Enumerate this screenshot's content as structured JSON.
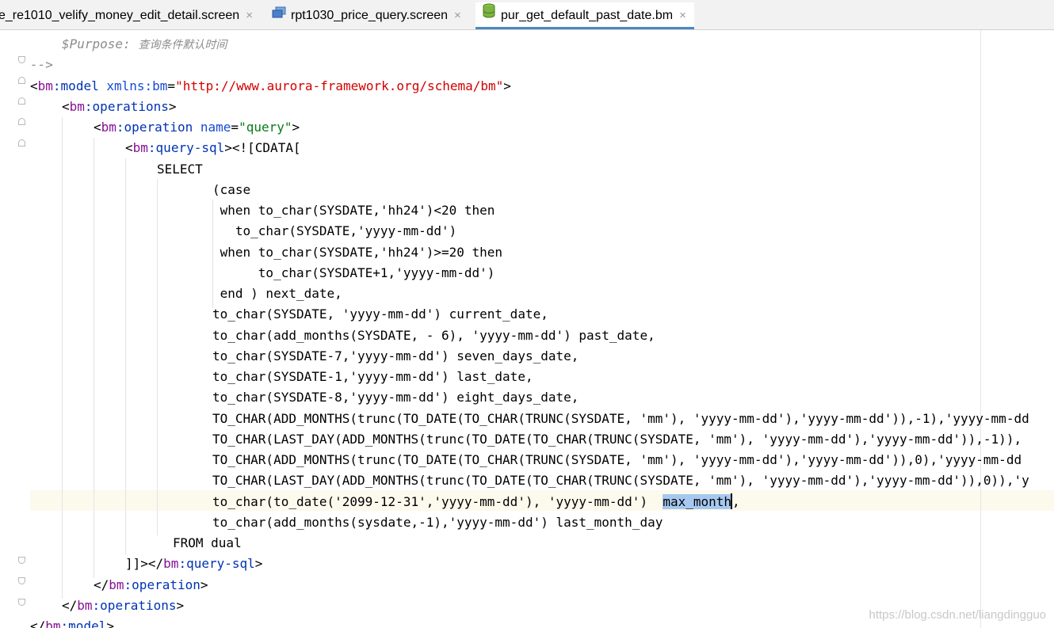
{
  "tabs": [
    {
      "label": "e_re1010_velify_money_edit_detail.screen",
      "active": false,
      "icon": "none"
    },
    {
      "label": "rpt1030_price_query.screen",
      "active": false,
      "icon": "screen-file-icon"
    },
    {
      "label": "pur_get_default_past_date.bm",
      "active": true,
      "icon": "database-file-icon"
    }
  ],
  "tab_close_glyph": "×",
  "code": {
    "purpose_key": "$Purpose:",
    "purpose_text": "查询条件默认时间",
    "comment_end": "-->",
    "model_ns": "bm",
    "model_tag": "model",
    "xmlns_attr": "xmlns:bm",
    "xmlns_url": "http://www.aurora-framework.org/schema/bm",
    "operations_tag": "operations",
    "operation_tag": "operation",
    "name_attr": "name",
    "name_value": "query",
    "querysql_tag": "query-sql",
    "cdata_open": "<![CDATA[",
    "cdata_close": "]]>",
    "sql_lines": [
      "SELECT",
      "(case",
      " when to_char(SYSDATE,'hh24')<20 then",
      "   to_char(SYSDATE,'yyyy-mm-dd')",
      " when to_char(SYSDATE,'hh24')>=20 then",
      "      to_char(SYSDATE+1,'yyyy-mm-dd')",
      " end ) next_date,",
      "to_char(SYSDATE, 'yyyy-mm-dd') current_date,",
      "to_char(add_months(SYSDATE, - 6), 'yyyy-mm-dd') past_date,",
      "to_char(SYSDATE-7,'yyyy-mm-dd') seven_days_date,",
      "to_char(SYSDATE-1,'yyyy-mm-dd') last_date,",
      "to_char(SYSDATE-8,'yyyy-mm-dd') eight_days_date,",
      "TO_CHAR(ADD_MONTHS(trunc(TO_DATE(TO_CHAR(TRUNC(SYSDATE, 'mm'), 'yyyy-mm-dd'),'yyyy-mm-dd')),-1),'yyyy-mm-dd",
      "TO_CHAR(LAST_DAY(ADD_MONTHS(trunc(TO_DATE(TO_CHAR(TRUNC(SYSDATE, 'mm'), 'yyyy-mm-dd'),'yyyy-mm-dd')),-1)),",
      "TO_CHAR(ADD_MONTHS(trunc(TO_DATE(TO_CHAR(TRUNC(SYSDATE, 'mm'), 'yyyy-mm-dd'),'yyyy-mm-dd')),0),'yyyy-mm-dd",
      "TO_CHAR(LAST_DAY(ADD_MONTHS(trunc(TO_DATE(TO_CHAR(TRUNC(SYSDATE, 'mm'), 'yyyy-mm-dd'),'yyyy-mm-dd')),0)),'y",
      "to_char(to_date('2099-12-31','yyyy-mm-dd'), 'yyyy-mm-dd')  ",
      "to_char(add_months(sysdate,-1),'yyyy-mm-dd') last_month_day",
      "FROM dual"
    ],
    "selected_word": "max_month",
    "after_selection": ","
  },
  "watermark": "https://blog.csdn.net/liangdingguo",
  "colors": {
    "tag": "#0033b3",
    "namespace": "#871094",
    "attr_value": "#067d17",
    "url": "#d40000",
    "selection": "#a6c8f0",
    "active_tab_underline": "#4a88c7"
  }
}
